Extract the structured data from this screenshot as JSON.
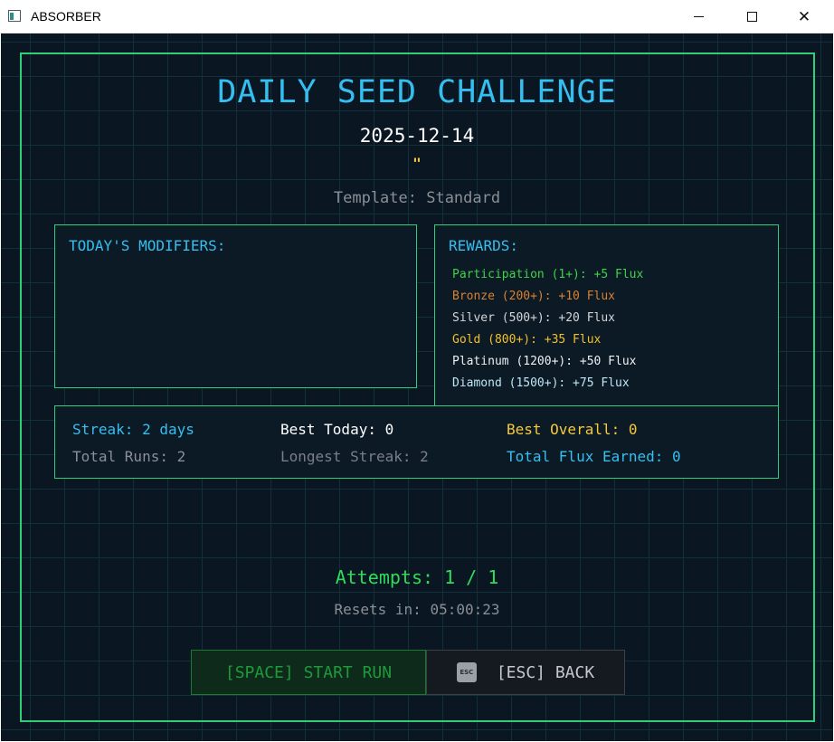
{
  "window": {
    "title": "ABSORBER",
    "minimize_glyph": "",
    "maximize_glyph": "",
    "close_glyph": "✕"
  },
  "header": {
    "title": "DAILY SEED CHALLENGE",
    "date": "2025-12-14",
    "quote_mark": "\"",
    "template": "Template: Standard"
  },
  "modifiers": {
    "title": "TODAY'S MODIFIERS:"
  },
  "rewards": {
    "title": "REWARDS:",
    "items": [
      {
        "label": "Participation (1+): +5 Flux",
        "color": "#3fd24a"
      },
      {
        "label": "Bronze (200+): +10 Flux",
        "color": "#d9812f"
      },
      {
        "label": "Silver (500+): +20 Flux",
        "color": "#d4d6d8"
      },
      {
        "label": "Gold (800+): +35 Flux",
        "color": "#f2c12a"
      },
      {
        "label": "Platinum (1200+): +50 Flux",
        "color": "#eef0f2"
      },
      {
        "label": "Diamond (1500+): +75 Flux",
        "color": "#bfe6f5"
      }
    ]
  },
  "stats": {
    "streak": "Streak: 2 days",
    "best_today": "Best Today: 0",
    "best_overall": "Best Overall: 0",
    "total_runs": "Total Runs: 2",
    "longest_streak": "Longest Streak: 2",
    "total_flux": "Total Flux Earned: 0"
  },
  "attempts": "Attempts: 1 / 1",
  "resets": "Resets in: 05:00:23",
  "buttons": {
    "start": "[SPACE] START RUN",
    "esc_key": "ESC",
    "back": "[ESC] BACK"
  },
  "colors": {
    "background": "#0a1723",
    "accent_green": "#2fcf7a",
    "accent_blue": "#35bff0",
    "gold": "#f5c93a",
    "muted": "#8a8f96"
  }
}
